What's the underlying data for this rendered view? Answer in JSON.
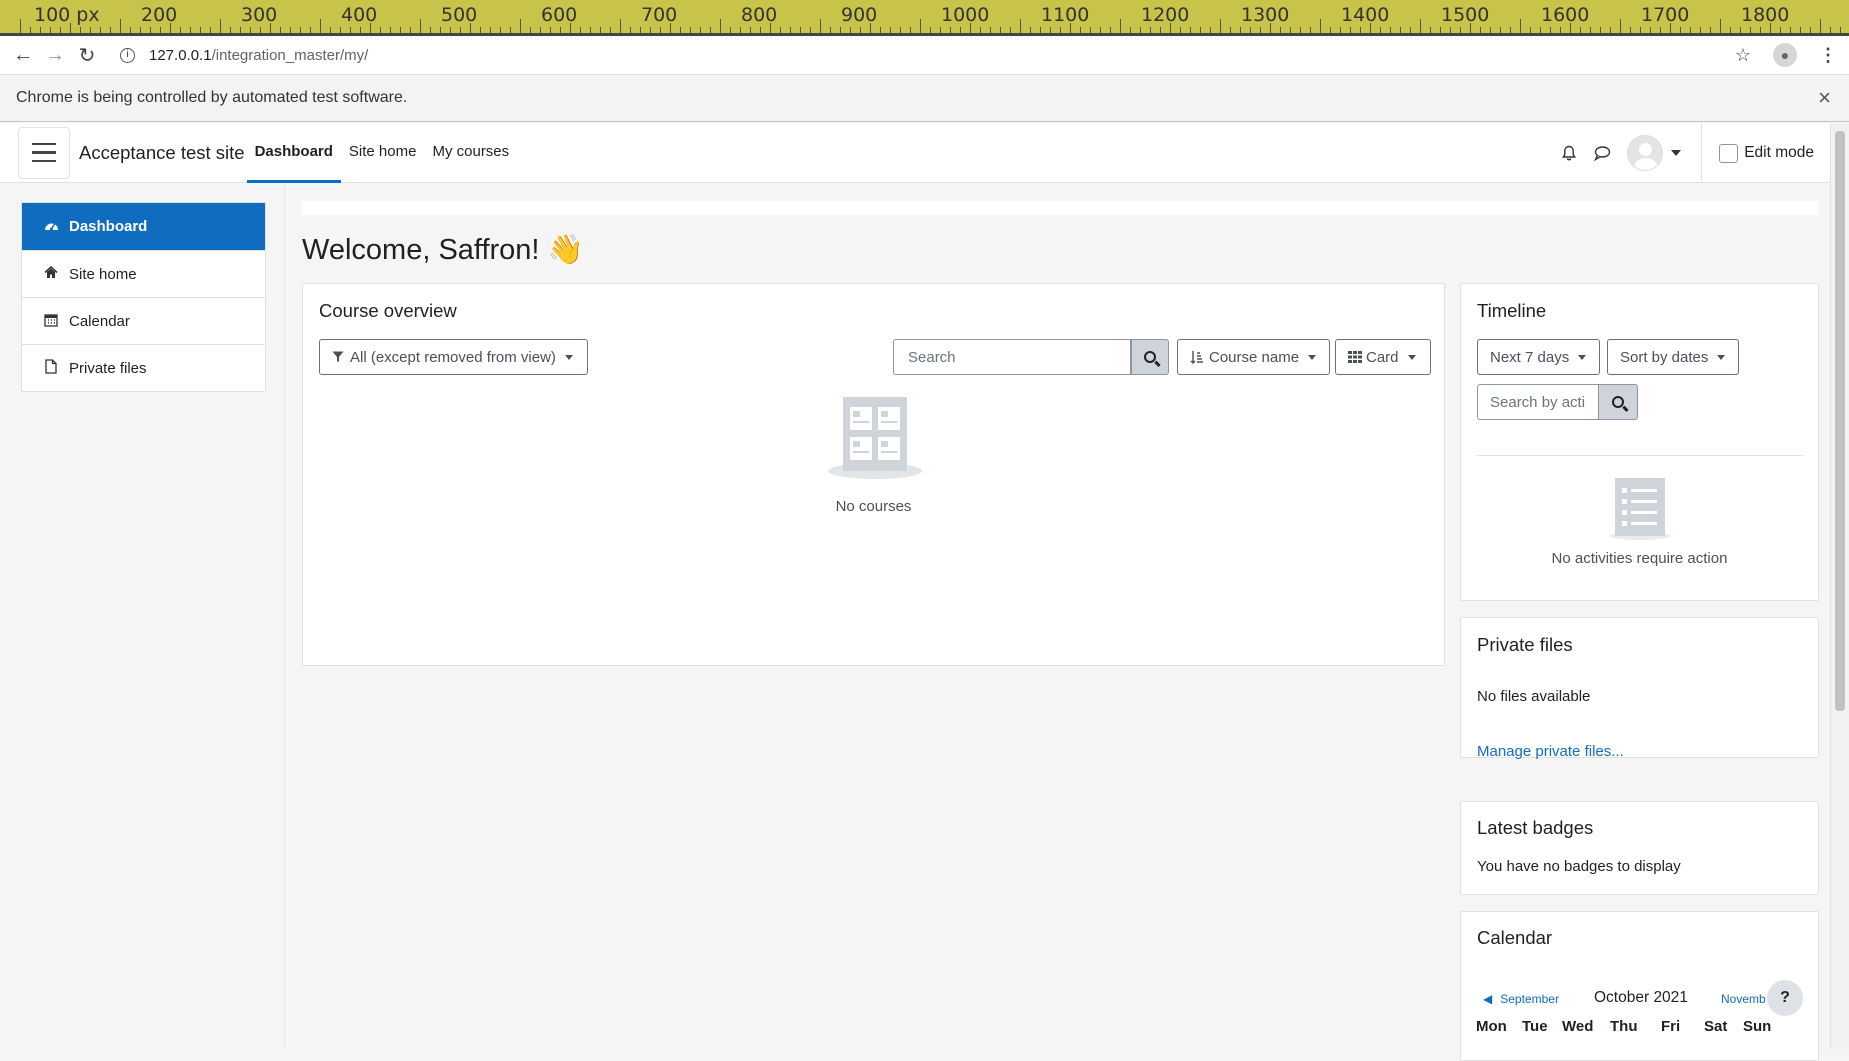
{
  "ruler": {
    "labels": [
      "100 px",
      "200",
      "300",
      "400",
      "500",
      "600",
      "700",
      "800",
      "900",
      "1000",
      "1100",
      "1200",
      "1300",
      "1400",
      "1500",
      "1600",
      "1700",
      "1800"
    ]
  },
  "browser": {
    "url_host": "127.0.0.1",
    "url_path": "/integration_master/my/",
    "back_icon": "arrow-left-icon",
    "forward_icon": "arrow-right-icon",
    "reload_icon": "reload-icon",
    "info_icon": "info-icon",
    "star_icon": "star-icon",
    "menu_icon": "kebab-menu-icon"
  },
  "infobar": {
    "text": "Chrome is being controlled by automated test software."
  },
  "navbar": {
    "site_name": "Acceptance test site",
    "links": [
      {
        "label": "Dashboard",
        "active": true
      },
      {
        "label": "Site home",
        "active": false
      },
      {
        "label": "My courses",
        "active": false
      }
    ],
    "edit_mode_label": "Edit mode"
  },
  "drawer": {
    "items": [
      {
        "label": "Dashboard",
        "icon": "dashboard-icon",
        "active": true
      },
      {
        "label": "Site home",
        "icon": "home-icon",
        "active": false
      },
      {
        "label": "Calendar",
        "icon": "calendar-icon",
        "active": false
      },
      {
        "label": "Private files",
        "icon": "file-icon",
        "active": false
      }
    ]
  },
  "main": {
    "welcome": "Welcome, Saffron! 👋",
    "course_overview": {
      "title": "Course overview",
      "filter_label": "All (except removed from view)",
      "search_placeholder": "Search",
      "sort_label": "Course name",
      "view_label": "Card",
      "empty_text": "No courses"
    }
  },
  "timeline": {
    "title": "Timeline",
    "range_label": "Next 7 days",
    "sort_label": "Sort by dates",
    "search_placeholder": "Search by acti",
    "empty_text": "No activities require action"
  },
  "private_files": {
    "title": "Private files",
    "empty_text": "No files available",
    "manage_link": "Manage private files..."
  },
  "badges": {
    "title": "Latest badges",
    "empty_text": "You have no badges to display"
  },
  "calendar": {
    "title": "Calendar",
    "prev_month": "September",
    "current_month": "October 2021",
    "next_month": "Novemb",
    "days": [
      "Mon",
      "Tue",
      "Wed",
      "Thu",
      "Fri",
      "Sat",
      "Sun"
    ],
    "help_label": "?"
  },
  "colors": {
    "primary": "#0f6cbf",
    "ruler": "#c8c44a"
  }
}
